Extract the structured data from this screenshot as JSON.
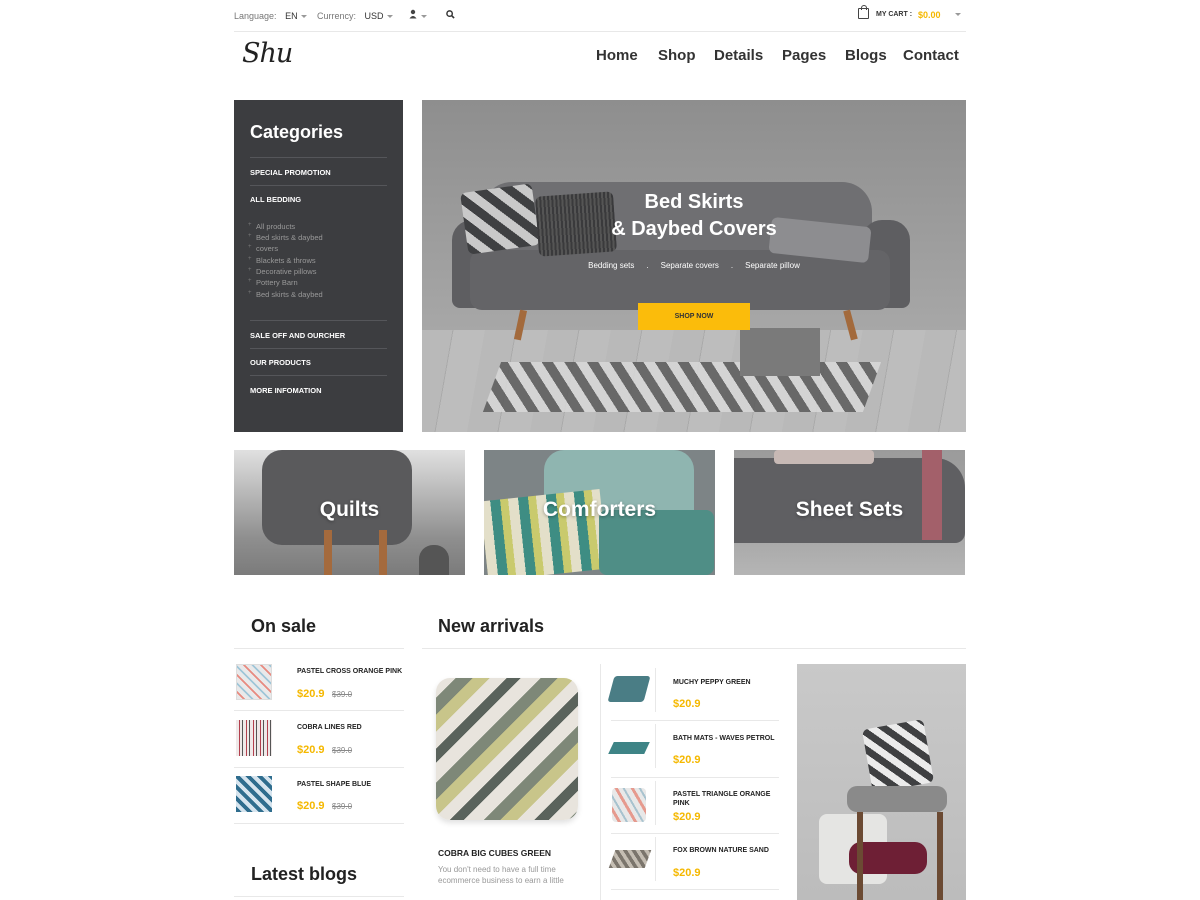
{
  "topbar": {
    "language_label": "Language:",
    "language_value": "EN",
    "currency_label": "Currency:",
    "currency_value": "USD",
    "user_icon": "user-icon",
    "search_icon": "search-icon",
    "cart_label": "MY CART :",
    "cart_total": "$0.00"
  },
  "header": {
    "logo": "Shu",
    "nav": [
      "Home",
      "Shop",
      "Details",
      "Pages",
      "Blogs",
      "Contact"
    ]
  },
  "categories": {
    "title": "Categories",
    "special": "SPECIAL PROMOTION",
    "all_bedding": "ALL BEDDING",
    "sub_items": [
      "All products",
      "Bed skirts & daybed",
      "covers",
      "Blackets & throws",
      "Decorative pillows",
      "Pottery Barn",
      "Bed skirts & daybed"
    ],
    "sale": "SALE OFF AND OURCHER",
    "products": "OUR PRODUCTS",
    "more": "MORE INFOMATION"
  },
  "hero": {
    "title_line1": "Bed Skirts",
    "title_line2": "& Daybed Covers",
    "tags": [
      "Bedding sets",
      ".",
      "Separate covers",
      ".",
      "Separate pillow"
    ],
    "button": "SHOP NOW"
  },
  "tiles": [
    "Quilts",
    "Comforters",
    "Sheet Sets"
  ],
  "on_sale": {
    "title": "On sale",
    "items": [
      {
        "name": "PASTEL CROSS ORANGE PINK",
        "price": "$20.9",
        "old_price": "$39.0"
      },
      {
        "name": "COBRA LINES RED",
        "price": "$20.9",
        "old_price": "$39.0"
      },
      {
        "name": "PASTEL SHAPE BLUE",
        "price": "$20.9",
        "old_price": "$39.0"
      }
    ]
  },
  "new_arrivals": {
    "title": "New arrivals",
    "featured": {
      "name": "COBRA BIG CUBES GREEN",
      "desc": "You don't need to have a full time ecommerce business to earn a little"
    },
    "items": [
      {
        "name": "MUCHY PEPPY GREEN",
        "price": "$20.9"
      },
      {
        "name": "BATH MATS - WAVES PETROL",
        "price": "$20.9"
      },
      {
        "name": "PASTEL TRIANGLE ORANGE PINK",
        "price": "$20.9"
      },
      {
        "name": "FOX BROWN NATURE SAND",
        "price": "$20.9"
      }
    ]
  },
  "latest_blogs": {
    "title": "Latest blogs"
  },
  "colors": {
    "accent": "#fbbc0b",
    "sidebar": "#3c3d40",
    "price": "#f5b800"
  }
}
